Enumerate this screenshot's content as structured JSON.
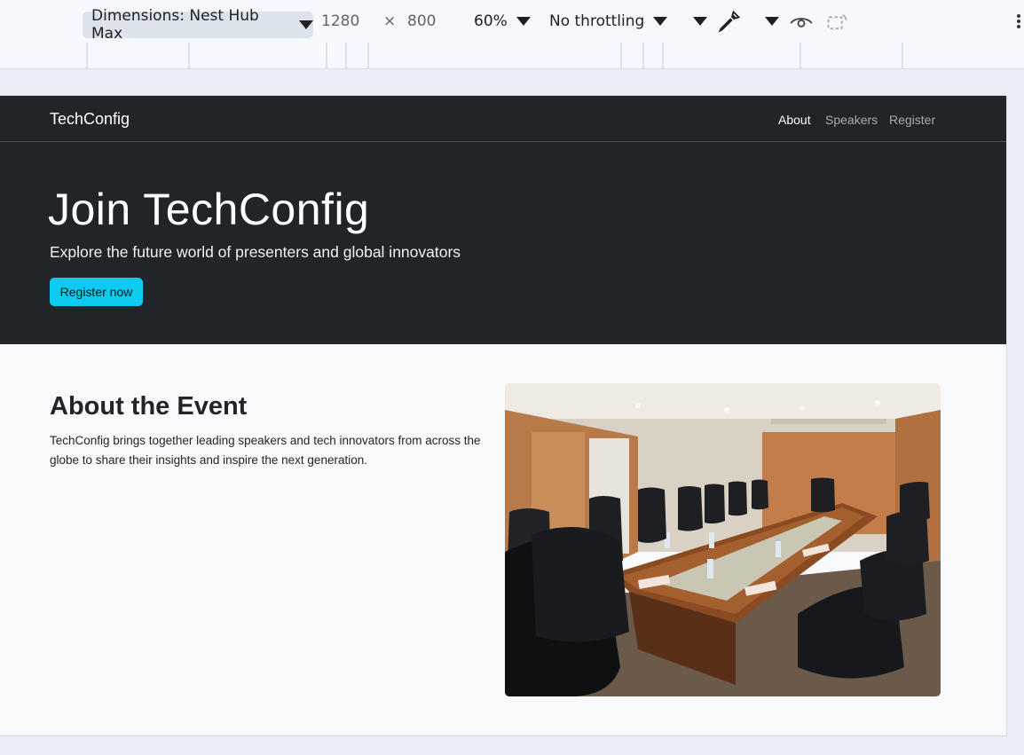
{
  "devtools": {
    "dimensions_label": "Dimensions: Nest Hub Max",
    "width": "1280",
    "times": "×",
    "height": "800",
    "zoom": "60%",
    "throttling": "No throttling"
  },
  "navbar": {
    "brand": "TechConfig",
    "links": [
      "About",
      "Speakers",
      "Register"
    ],
    "active_link": "About"
  },
  "hero": {
    "title": "Join TechConfig",
    "subtitle": "Explore the future world of presenters and global innovators",
    "button": "Register now",
    "button_color": "#0dcaf0"
  },
  "about": {
    "title": "About the Event",
    "text": "TechConfig brings together leading speakers and tech innovators from across the globe to share their insights and inspire the next generation."
  },
  "colors": {
    "navbar_bg": "#212529",
    "page_bg": "#f8f9fb"
  }
}
